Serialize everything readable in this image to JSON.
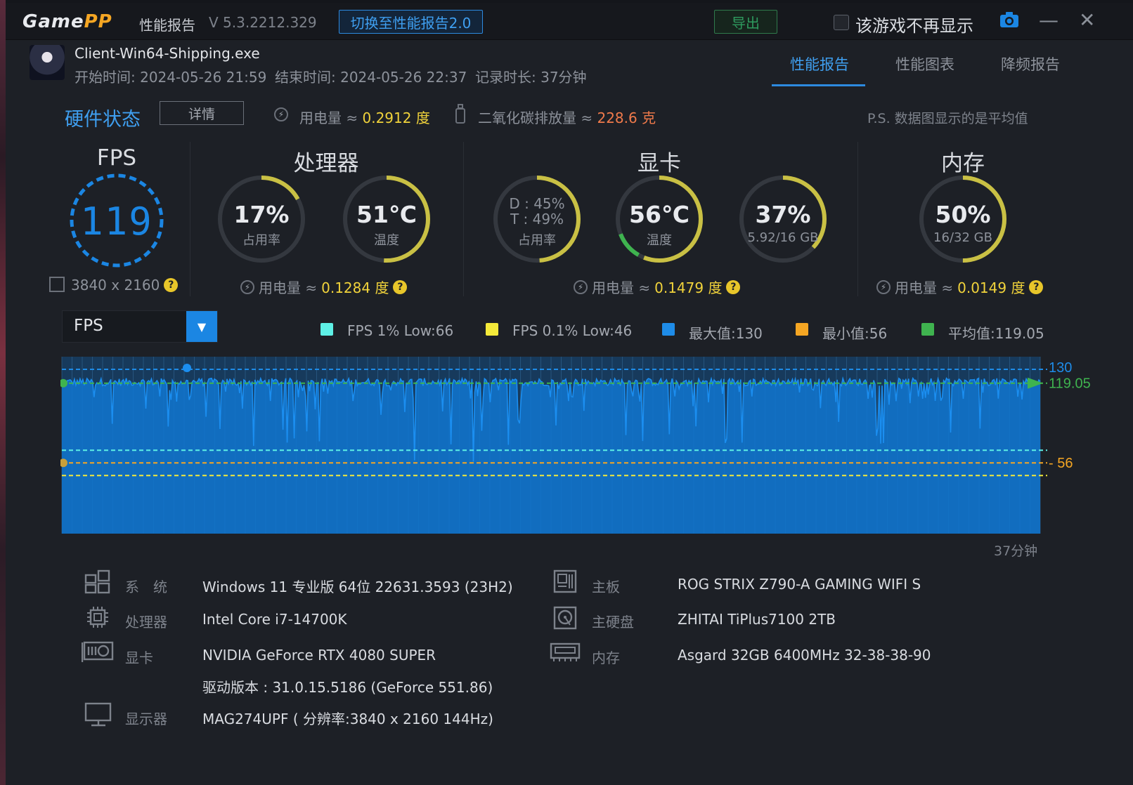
{
  "titlebar": {
    "logo_main": "Game",
    "logo_accent": "PP",
    "title": "性能报告",
    "version": "V 5.3.2212.329",
    "switch_label": "切换至性能报告2.0",
    "export_label": "导出",
    "hide_label": "该游戏不再显示",
    "minimize": "—",
    "close": "✕"
  },
  "session": {
    "exe": "Client-Win64-Shipping.exe",
    "start": "开始时间: 2024-05-26 21:59",
    "end": "结束时间: 2024-05-26 22:37",
    "duration": "记录时长: 37分钟"
  },
  "tabs": [
    {
      "label": "性能报告",
      "active": true
    },
    {
      "label": "性能图表",
      "active": false
    },
    {
      "label": "降频报告",
      "active": false
    }
  ],
  "hardware": {
    "title": "硬件状态",
    "detail_label": "详情",
    "power_label": "用电量 ≈",
    "power_value": "0.2912 度",
    "co2_label": "二氧化碳排放量 ≈",
    "co2_value": "228.6 克",
    "note": "P.S. 数据图显示的是平均值"
  },
  "fps": {
    "title": "FPS",
    "value": "119",
    "resolution": "3840 x 2160"
  },
  "cpu": {
    "title": "处理器",
    "usage_value": "17%",
    "usage_label": "占用率",
    "usage_fraction": 0.17,
    "temp_value": "51℃",
    "temp_label": "温度",
    "temp_fraction": 0.51,
    "power_label": "用电量 ≈",
    "power_value": "0.1284 度"
  },
  "gpu": {
    "title": "显卡",
    "usage_d": "D : 45%",
    "usage_t": "T : 49%",
    "usage_label": "占用率",
    "usage_fraction": 0.49,
    "temp_value": "56℃",
    "temp_label": "温度",
    "temp_fraction": 0.56,
    "vram_value": "37%",
    "vram_label": "5.92/16 GB",
    "vram_fraction": 0.37,
    "power_label": "用电量 ≈",
    "power_value": "0.1479 度"
  },
  "memory": {
    "title": "内存",
    "usage_value": "50%",
    "usage_label": "16/32 GB",
    "usage_fraction": 0.5,
    "power_label": "用电量 ≈",
    "power_value": "0.0149 度"
  },
  "chart_controls": {
    "metric": "FPS"
  },
  "legend": [
    {
      "label": "FPS 1% Low:66",
      "color": "#5ef0e6"
    },
    {
      "label": "FPS 0.1% Low:46",
      "color": "#f4ea3a"
    },
    {
      "label": "最大值:130",
      "color": "#1e8ce8"
    },
    {
      "label": "最小值:56",
      "color": "#f5a623"
    },
    {
      "label": "平均值:119.05",
      "color": "#3fb34f"
    }
  ],
  "chart_data": {
    "type": "area",
    "series": [
      {
        "name": "FPS",
        "color": "#1b86e3"
      }
    ],
    "max": 130,
    "min": 56,
    "avg": 119.05,
    "low_1pct": 66,
    "low_01pct": 46,
    "max_label": "130",
    "avg_label": "119.05",
    "min_label": "56",
    "duration_label": "37分钟",
    "y_range": [
      0,
      140
    ]
  },
  "specs": {
    "os_label": "系　统",
    "os_value": "Windows 11 专业版 64位 22631.3593 (23H2)",
    "cpu_label": "处理器",
    "cpu_value": "Intel Core i7-14700K",
    "gpu_label": "显卡",
    "gpu_value": "NVIDIA GeForce RTX 4080 SUPER",
    "driver_value": "驱动版本 : 31.0.15.5186 (GeForce 551.86)",
    "monitor_label": "显示器",
    "monitor_value": "MAG274UPF ( 分辨率:3840 x 2160 144Hz)",
    "board_label": "主板",
    "board_value": "ROG STRIX Z790-A GAMING WIFI S",
    "disk_label": "主硬盘",
    "disk_value": "ZHITAI TiPlus7100 2TB",
    "ram_label": "内存",
    "ram_value": "Asgard 32GB 6400MHz 32-38-38-90"
  }
}
